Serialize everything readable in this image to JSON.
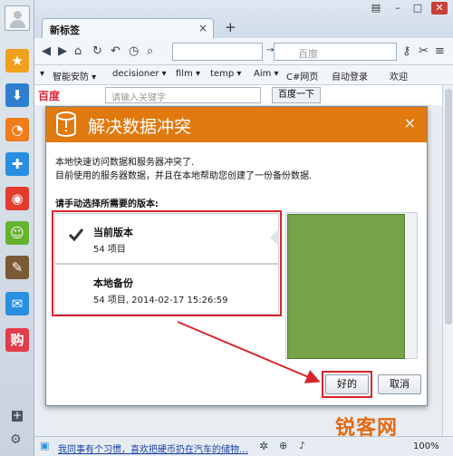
{
  "browser": {
    "tab_title": "新标签",
    "tab_close": "×",
    "new_tab": "+",
    "search_placeholder": "百度",
    "bookmarks": [
      "智能安防 ▾",
      "decisioner ▾",
      "film ▾",
      "temp ▾",
      "Aim ▾",
      "C#网页",
      "自动登录",
      "欢迎"
    ],
    "page_logo": "百度",
    "page_search_placeholder": "请输入关键字",
    "page_search_button": "百度一下",
    "status_link": "我同事有个习惯，喜欢把硬币扔在汽车的储物…",
    "zoom": "100%"
  },
  "dialog": {
    "title": "解决数据冲突",
    "close": "×",
    "line1": "本地快速访问数据和服务器冲突了.",
    "line2": "目前使用的服务器数据，并且在本地帮助您创建了一份备份数据.",
    "choose_label": "请手动选择所需要的版本:",
    "versions": [
      {
        "title": "当前版本",
        "sub": "54 项目"
      },
      {
        "title": "本地备份",
        "sub": "54 项目, 2014-02-17 15:26:59"
      }
    ],
    "ok": "好的",
    "cancel": "取消"
  },
  "watermark": "锐客网",
  "colors": {
    "header": "#e07a10",
    "highlight": "#d8252b",
    "preview": "#76a34a"
  }
}
